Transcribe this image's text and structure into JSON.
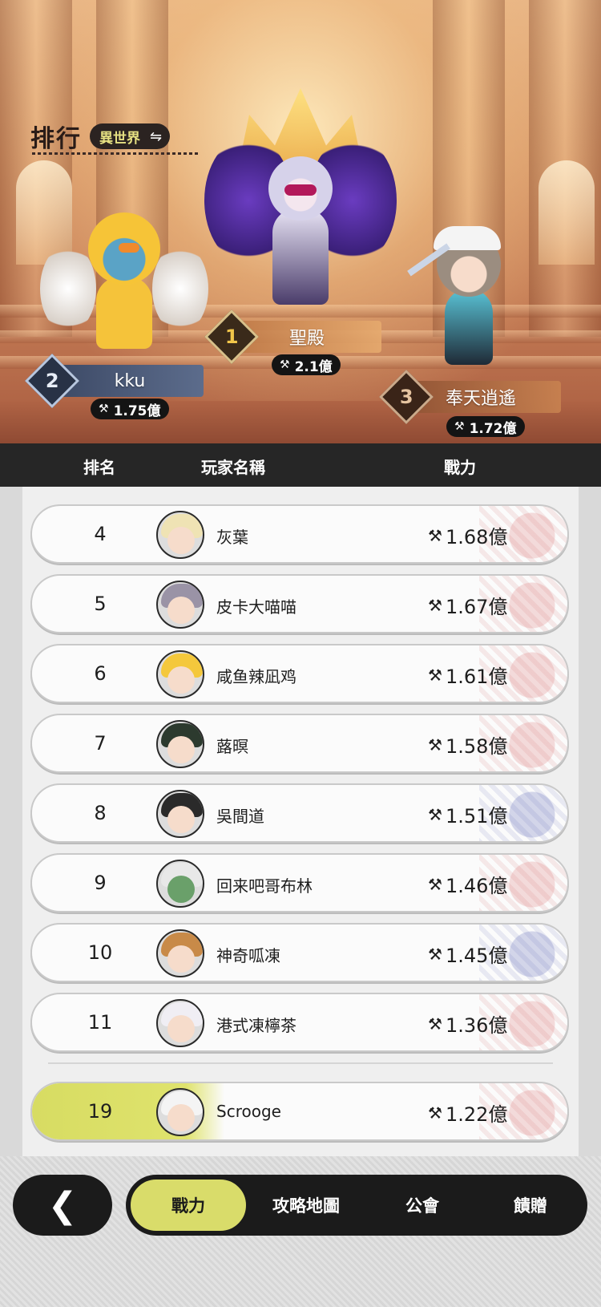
{
  "hero": {
    "title": "排行",
    "world_label": "異世界",
    "swap_icon": "swap-icon",
    "podium": [
      {
        "rank": "1",
        "name": "聖殿",
        "power": "2.1億"
      },
      {
        "rank": "2",
        "name": "kku",
        "power": "1.75億"
      },
      {
        "rank": "3",
        "name": "奉天逍遙",
        "power": "1.72億"
      }
    ]
  },
  "table": {
    "headers": {
      "rank": "排名",
      "player": "玩家名稱",
      "power": "戰力"
    },
    "rows": [
      {
        "rank": "4",
        "name": "灰葉",
        "power": "1.68億"
      },
      {
        "rank": "5",
        "name": "皮卡大喵喵",
        "power": "1.67億"
      },
      {
        "rank": "6",
        "name": "咸鱼辣凪鸡",
        "power": "1.61億"
      },
      {
        "rank": "7",
        "name": "蕗暝",
        "power": "1.58億"
      },
      {
        "rank": "8",
        "name": "吳間道",
        "power": "1.51億"
      },
      {
        "rank": "9",
        "name": "回来吧哥布林",
        "power": "1.46億"
      },
      {
        "rank": "10",
        "name": "神奇呱凍",
        "power": "1.45億"
      },
      {
        "rank": "11",
        "name": "港式凍檸茶",
        "power": "1.36億"
      }
    ],
    "me": {
      "rank": "19",
      "name": "Scrooge",
      "power": "1.22億"
    }
  },
  "nav": {
    "back_icon": "back-arrow-icon",
    "tabs": [
      {
        "label": "戰力",
        "active": true
      },
      {
        "label": "攻略地圖",
        "active": false
      },
      {
        "label": "公會",
        "active": false
      },
      {
        "label": "饋贈",
        "active": false
      }
    ]
  },
  "colors": {
    "accent": "#d9dc6a",
    "dark": "#1b1b1b",
    "header_bg": "#262626"
  }
}
